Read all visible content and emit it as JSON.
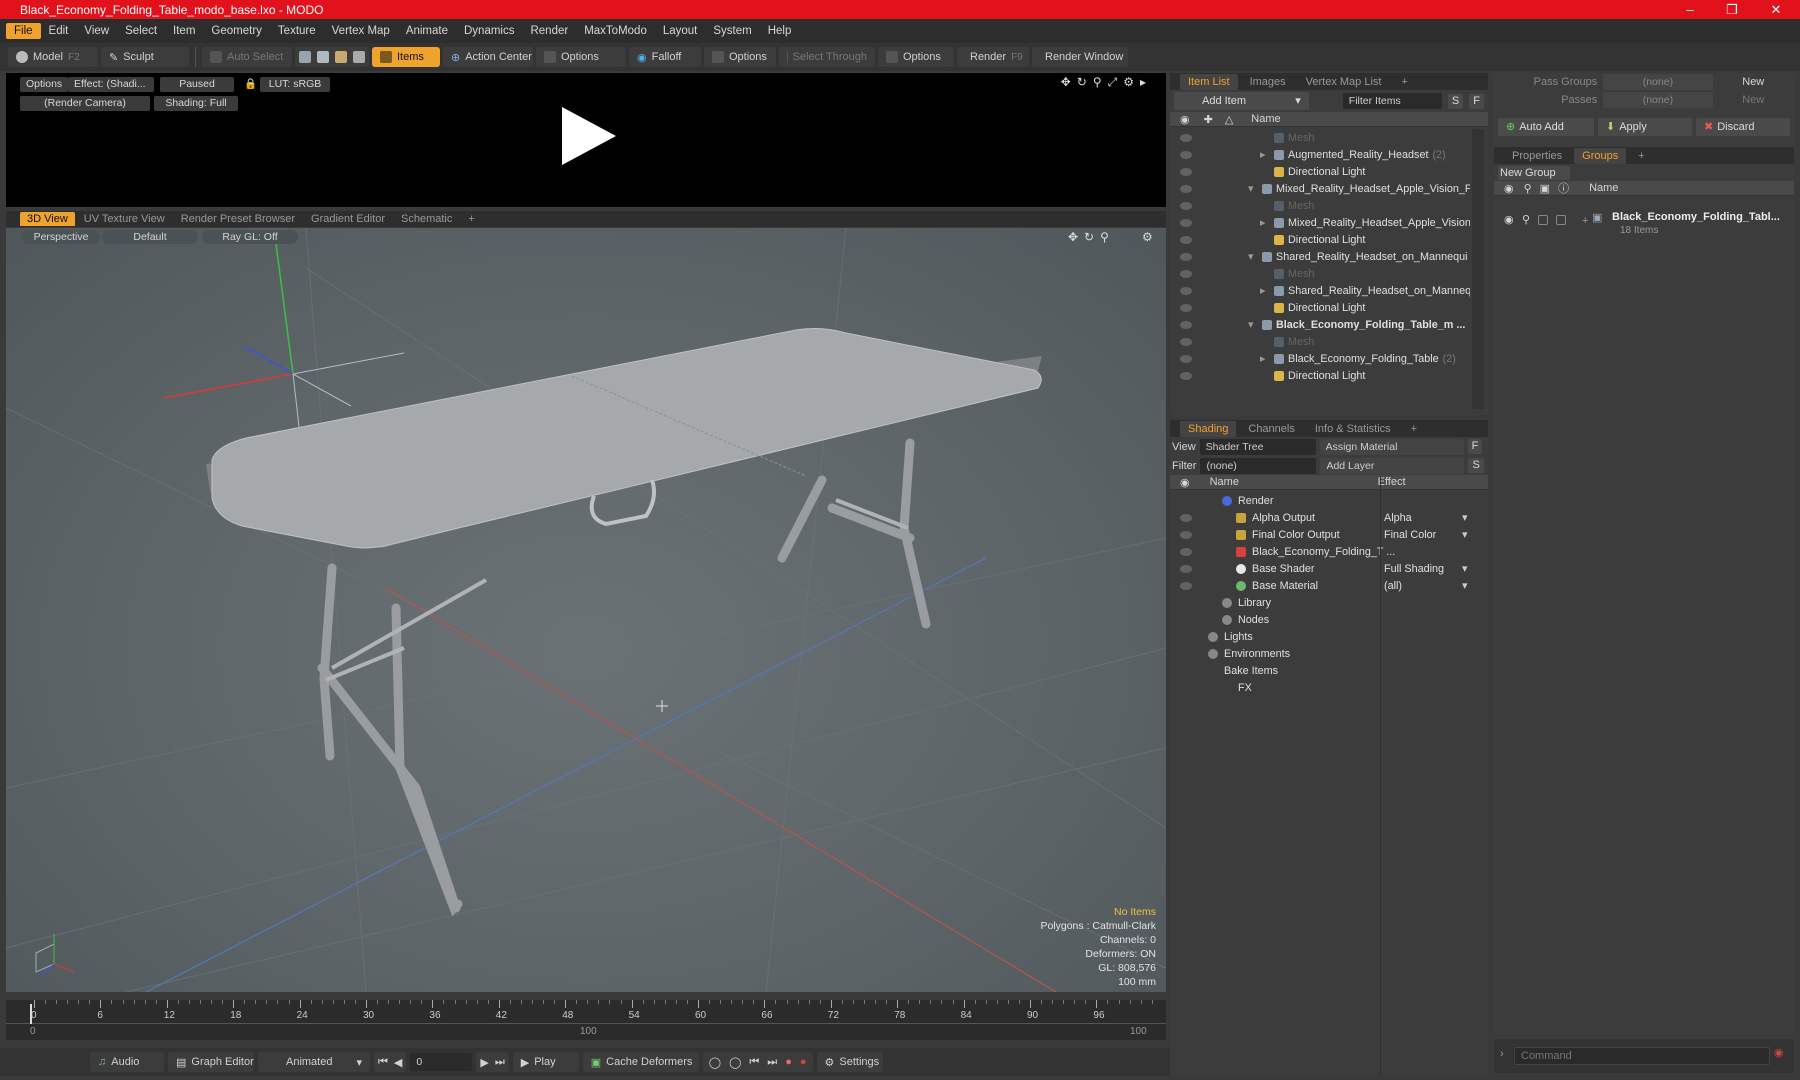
{
  "window": {
    "title": "Black_Economy_Folding_Table_modo_base.lxo - MODO"
  },
  "menu": [
    "File",
    "Edit",
    "View",
    "Select",
    "Item",
    "Geometry",
    "Texture",
    "Vertex Map",
    "Animate",
    "Dynamics",
    "Render",
    "MaxToModo",
    "Layout",
    "System",
    "Help"
  ],
  "toolbar": {
    "model": "Model",
    "model_key": "F2",
    "sculpt": "Sculpt",
    "auto_select": "Auto Select",
    "items": "Items",
    "action_center": "Action Center",
    "options1": "Options",
    "falloff": "Falloff",
    "options2": "Options",
    "select_through": "Select Through",
    "options3": "Options",
    "render": "Render",
    "render_key": "F9",
    "render_window": "Render Window"
  },
  "preview": {
    "options": "Options",
    "effect": "Effect: (Shadi...",
    "paused": "Paused",
    "lut": "LUT: sRGB",
    "camera": "(Render Camera)",
    "shading": "Shading: Full"
  },
  "viewport_tabs": [
    "3D View",
    "UV Texture View",
    "Render Preset Browser",
    "Gradient Editor",
    "Schematic"
  ],
  "viewport": {
    "perspective": "Perspective",
    "default": "Default",
    "raygl": "Ray GL: Off"
  },
  "stats": {
    "no_items": "No Items",
    "polygons": "Polygons : Catmull-Clark",
    "channels": "Channels: 0",
    "deformers": "Deformers: ON",
    "gl": "GL: 808,576",
    "scale": "100 mm"
  },
  "timeline": {
    "ticks": [
      "0",
      "6",
      "12",
      "18",
      "24",
      "30",
      "36",
      "42",
      "48",
      "54",
      "60",
      "66",
      "72",
      "78",
      "84",
      "90",
      "96"
    ],
    "sub_start": "0",
    "sub_mid": "100",
    "sub_end": "100"
  },
  "bottom": {
    "audio": "Audio",
    "graph_editor": "Graph Editor",
    "animated": "Animated",
    "frame": "0",
    "play": "Play",
    "cache": "Cache Deformers",
    "settings": "Settings"
  },
  "item_list": {
    "tabs": [
      "Item List",
      "Images",
      "Vertex Map List"
    ],
    "add_item": "Add Item",
    "filter_items": "Filter Items",
    "name_header": "Name",
    "rows": [
      {
        "label": "Mesh",
        "indent": 3,
        "dim": true
      },
      {
        "label": "Augmented_Reality_Headset",
        "count": "(2)",
        "indent": 3
      },
      {
        "label": "Directional Light",
        "indent": 3
      },
      {
        "label": "Mixed_Reality_Headset_Apple_Vision_P ...",
        "indent": 2
      },
      {
        "label": "Mesh",
        "indent": 3,
        "dim": true
      },
      {
        "label": "Mixed_Reality_Headset_Apple_Vision ...",
        "indent": 3
      },
      {
        "label": "Directional Light",
        "indent": 3
      },
      {
        "label": "Shared_Reality_Headset_on_Mannequi ...",
        "indent": 2
      },
      {
        "label": "Mesh",
        "indent": 3,
        "dim": true
      },
      {
        "label": "Shared_Reality_Headset_on_Manneq...",
        "indent": 3
      },
      {
        "label": "Directional Light",
        "indent": 3
      },
      {
        "label": "Black_Economy_Folding_Table_m ...",
        "indent": 2,
        "bold": true
      },
      {
        "label": "Mesh",
        "indent": 3,
        "dim": true
      },
      {
        "label": "Black_Economy_Folding_Table",
        "count": "(2)",
        "indent": 3
      },
      {
        "label": "Directional Light",
        "indent": 3
      }
    ]
  },
  "shading": {
    "tabs": [
      "Shading",
      "Channels",
      "Info & Statistics"
    ],
    "view_label": "View",
    "view_value": "Shader Tree",
    "assign_material": "Assign Material",
    "filter_label": "Filter",
    "filter_value": "(none)",
    "add_layer": "Add Layer",
    "name_header": "Name",
    "effect_header": "Effect",
    "rows": [
      {
        "label": "Render",
        "effect": "",
        "indent": 1
      },
      {
        "label": "Alpha Output",
        "effect": "Alpha",
        "indent": 2
      },
      {
        "label": "Final Color Output",
        "effect": "Final Color",
        "indent": 2
      },
      {
        "label": "Black_Economy_Folding_T ...",
        "effect": "",
        "indent": 2
      },
      {
        "label": "Base Shader",
        "effect": "Full Shading",
        "indent": 2
      },
      {
        "label": "Base Material",
        "effect": "(all)",
        "indent": 2
      },
      {
        "label": "Library",
        "effect": "",
        "indent": 1
      },
      {
        "label": "Nodes",
        "effect": "",
        "indent": 1
      },
      {
        "label": "Lights",
        "effect": "",
        "indent": 0
      },
      {
        "label": "Environments",
        "effect": "",
        "indent": 0
      },
      {
        "label": "Bake Items",
        "effect": "",
        "indent": 0
      },
      {
        "label": "FX",
        "effect": "",
        "indent": 1
      }
    ]
  },
  "groups": {
    "pass_groups": "Pass Groups",
    "pass_value": "(none)",
    "new": "New",
    "passes": "Passes",
    "passes_value": "(none)",
    "new2": "New",
    "auto_add": "Auto Add",
    "apply": "Apply",
    "discard": "Discard",
    "tabs": [
      "Properties",
      "Groups"
    ],
    "new_group": "New Group",
    "name_header": "Name",
    "group_name": "Black_Economy_Folding_Tabl...",
    "group_count": "18 Items"
  },
  "command": {
    "placeholder": "Command"
  }
}
